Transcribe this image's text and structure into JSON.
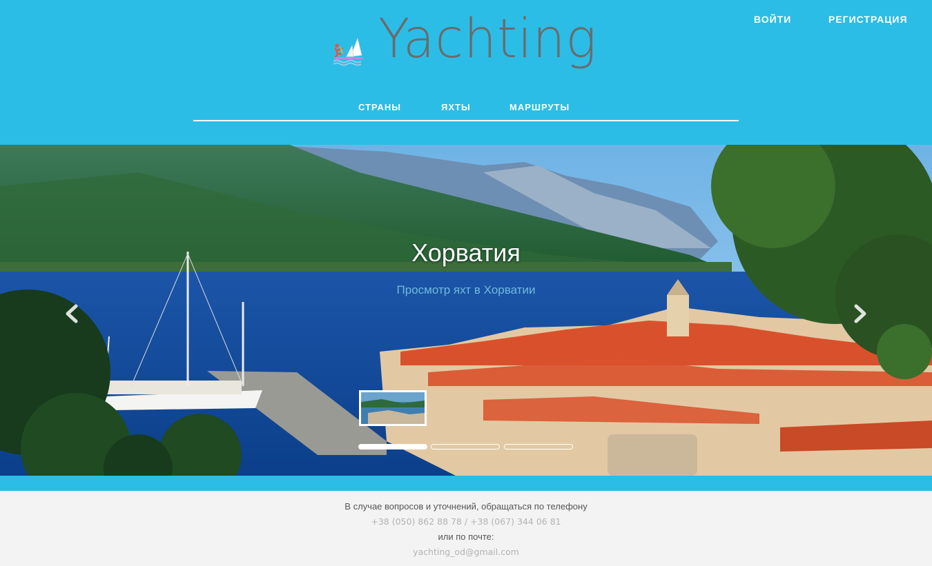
{
  "header": {
    "login_label": "ВОЙТИ",
    "register_label": "РЕГИСТРАЦИЯ",
    "logo_text": "Yachting",
    "logo_icon": "windsurfer-sailboat-icon"
  },
  "nav": {
    "items": [
      {
        "label": "СТРАНЫ"
      },
      {
        "label": "ЯХТЫ"
      },
      {
        "label": "МАРШРУТЫ"
      }
    ]
  },
  "carousel": {
    "title": "Хорватия",
    "subtitle": "Просмотр яхт в Хорватии",
    "prev_icon": "chevron-left-icon",
    "next_icon": "chevron-right-icon",
    "indicator_count": 3,
    "active_indicator": 1
  },
  "footer": {
    "line1": "В случае вопросов и уточнений, обращаться по телефону",
    "phones": "+38 (050) 862 88 78 / +38 (067) 344 06 81",
    "line3": "или по почте:",
    "email": "yachting_od@gmail.com"
  },
  "colors": {
    "header_bg": "#2bbde6",
    "footer_bg": "#f3f3f3",
    "logo_text": "#6b6b6b",
    "subtitle": "#6fb9dc"
  }
}
